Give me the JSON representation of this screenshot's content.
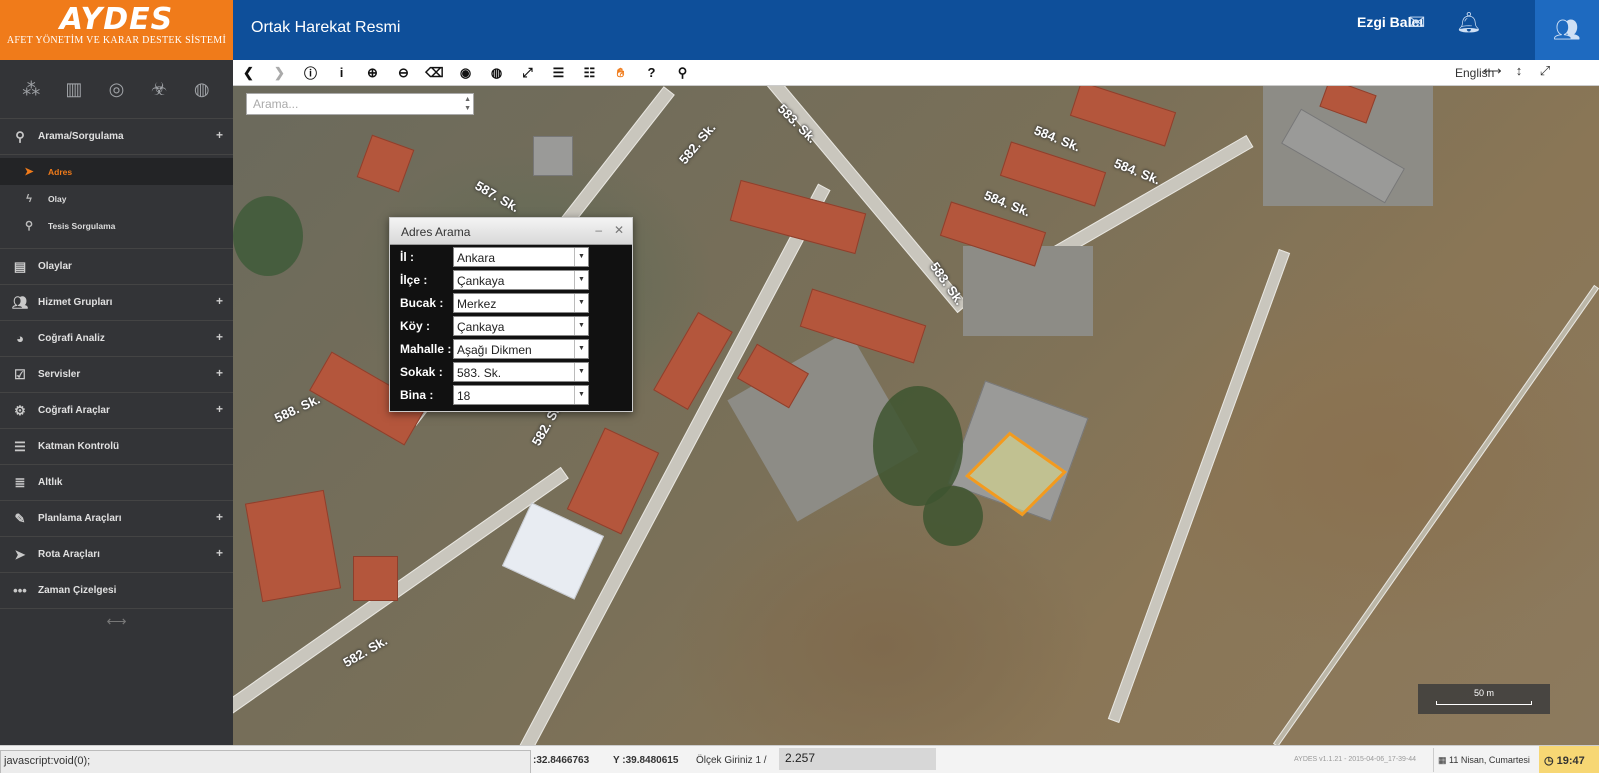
{
  "logo": {
    "brand": "AYDES",
    "subtitle": "AFET YÖNETİM VE KARAR DESTEK SİSTEMİ"
  },
  "header": {
    "title": "Ortak Harekat Resmi",
    "user": "Ezgi Balcı"
  },
  "sidebar": {
    "sections": [
      {
        "label": "Arama/Sorgulama",
        "icon": "search-icon",
        "expandable": true
      },
      {
        "label": "Olaylar",
        "icon": "list-icon",
        "expandable": false
      },
      {
        "label": "Hizmet Grupları",
        "icon": "users-icon",
        "expandable": true
      },
      {
        "label": "Coğrafi Analiz",
        "icon": "pie-chart-icon",
        "expandable": true
      },
      {
        "label": "Servisler",
        "icon": "checkbox-icon",
        "expandable": true
      },
      {
        "label": "Coğrafi Araçlar",
        "icon": "gears-icon",
        "expandable": true
      },
      {
        "label": "Katman Kontrolü",
        "icon": "layers-icon",
        "expandable": false
      },
      {
        "label": "Altlık",
        "icon": "basemap-icon",
        "expandable": false
      },
      {
        "label": "Planlama Araçları",
        "icon": "edit-icon",
        "expandable": true
      },
      {
        "label": "Rota Araçları",
        "icon": "route-arrow-icon",
        "expandable": true
      },
      {
        "label": "Zaman Çizelgesi",
        "icon": "ellipsis-icon",
        "expandable": false
      }
    ],
    "sub_items": [
      {
        "label": "Adres",
        "icon": "location-arrow-icon",
        "active": true
      },
      {
        "label": "Olay",
        "icon": "bolt-icon",
        "active": false
      },
      {
        "label": "Tesis Sorgulama",
        "icon": "map-pin-icon",
        "active": false
      }
    ]
  },
  "toolbar": {
    "language": "English"
  },
  "map": {
    "search_placeholder": "Arama...",
    "street_labels": [
      "582. Sk.",
      "583. Sk.",
      "584. Sk.",
      "584. Sk.",
      "584. Sk.",
      "583. Sk.",
      "587. Sk.",
      "588. Sk.",
      "582. Sk.",
      "582. Sk."
    ],
    "scale_label": "50 m"
  },
  "dialog": {
    "title": "Adres Arama",
    "fields": [
      {
        "label": "İl :",
        "value": "Ankara"
      },
      {
        "label": "İlçe :",
        "value": "Çankaya"
      },
      {
        "label": "Bucak :",
        "value": "Merkez"
      },
      {
        "label": "Köy :",
        "value": "Çankaya"
      },
      {
        "label": "Mahalle :",
        "value": "Aşağı Dikmen"
      },
      {
        "label": "Sokak :",
        "value": "583. Sk."
      },
      {
        "label": "Bina :",
        "value": "18"
      }
    ]
  },
  "status": {
    "js_text": "javascript:void(0);",
    "x_coord": ":32.8466763",
    "y_coord": "Y :39.8480615",
    "scale_label": "Ölçek Giriniz 1 /",
    "scale_value": "2.257",
    "version": "AYDES v1.1.21 - 2015-04-06_17-39-44",
    "date": "11 Nisan, Cumartesi",
    "time": "19:47"
  },
  "colors": {
    "brand_orange": "#f07b1a",
    "header_blue": "#0e4f9a",
    "sidebar_dark": "#333437",
    "parcel_outline": "#f39a1e"
  }
}
